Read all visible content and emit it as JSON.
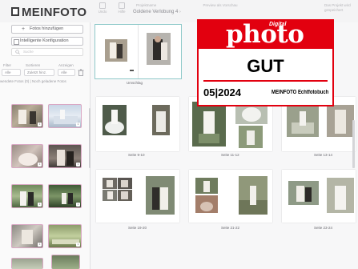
{
  "app": {
    "logo_text": "MEINFOTO",
    "toolbar": [
      {
        "label": "Undo",
        "icon": "undo-icon"
      },
      {
        "label": "Hilfe",
        "icon": "help-icon"
      }
    ],
    "project_label": "Projektname",
    "project_title": "Goldene Verlobung 4",
    "project_chevron": "›",
    "preview_label": "Preview als Vorschau",
    "top_right_lines": [
      "Das Projekt wird",
      "gespeichert"
    ]
  },
  "sidebar": {
    "add_photos": "Fotos hinzufügen",
    "add_photos_plus": "+",
    "ai_config": "Intelligente Konfiguration",
    "search_placeholder": "Suche",
    "filter_labels": [
      "Filter",
      "Sortieren",
      "Anzeigen"
    ],
    "filter_values": [
      "Alle",
      "Zuletzt hinz.",
      "Alle"
    ],
    "filter_note": "wendete Fotos (0) | Noch geladene Fotos",
    "thumb_badge": "1"
  },
  "main": {
    "cover_label": "Umschlag",
    "page_labels": [
      "Seite 9-10",
      "Seite 11-12",
      "Seite 13-14",
      "Seite 19-20",
      "Seite 21-22",
      "Seite 23-24"
    ]
  },
  "award": {
    "digital": "Digital",
    "brand": "photo",
    "rating": "GUT",
    "issue": "05|2024",
    "product": "MEINFOTO Echtfotobuch"
  },
  "colors": {
    "accent": "#e2000f",
    "selection": "#8fc9c9",
    "thumb_border": "#d9a8c4"
  }
}
